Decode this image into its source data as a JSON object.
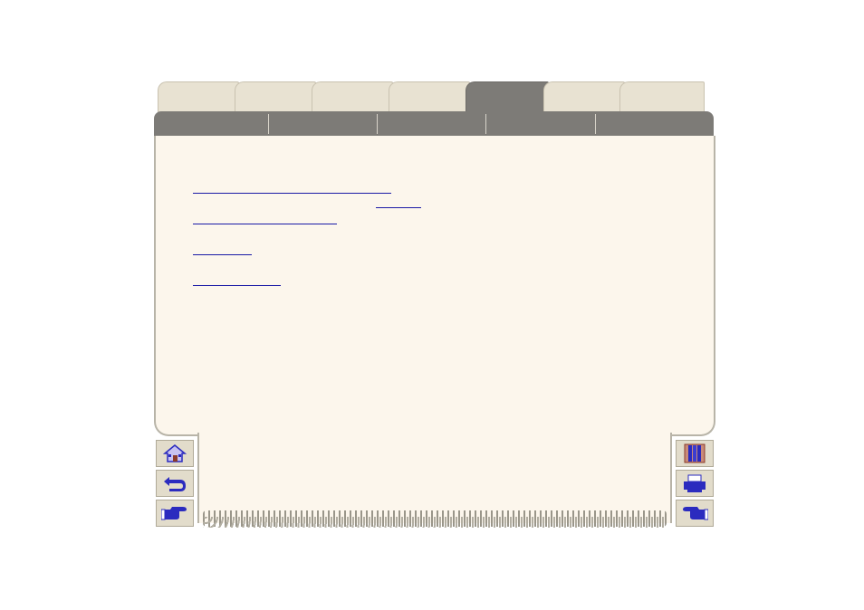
{
  "tabs": [
    {
      "label": "",
      "active": false
    },
    {
      "label": "",
      "active": false
    },
    {
      "label": "",
      "active": false
    },
    {
      "label": "",
      "active": false
    },
    {
      "label": "",
      "active": true
    },
    {
      "label": "",
      "active": false
    },
    {
      "label": "",
      "active": false
    }
  ],
  "header_sections": [
    "",
    "",
    "",
    "",
    ""
  ],
  "links": [
    "",
    "",
    "",
    "",
    ""
  ],
  "nav_left": [
    {
      "name": "home-icon"
    },
    {
      "name": "back-icon"
    },
    {
      "name": "next-page-icon"
    }
  ],
  "nav_right": [
    {
      "name": "contents-icon"
    },
    {
      "name": "print-icon"
    },
    {
      "name": "previous-page-icon"
    }
  ],
  "colors": {
    "tab": "#e8e2d2",
    "active_tab": "#7d7b77",
    "page": "#fcf6ec",
    "link": "#1a1aa6",
    "icon": "#2b2bbf"
  }
}
